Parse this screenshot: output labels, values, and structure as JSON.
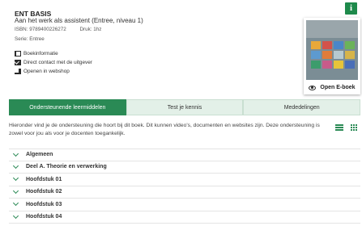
{
  "book": {
    "title": "ENT BASIS",
    "subtitle": "Aan het werk als assistent (Entree, niveau 1)",
    "isbn": "ISBN: 9789400226272",
    "druk": "Druk: 1hz",
    "serie": "Serie: Entree"
  },
  "info_badge": "i",
  "links": [
    {
      "label": "Boekinformatie",
      "icon": "book-icon"
    },
    {
      "label": "Direct contact met de uitgever",
      "icon": "mail-icon"
    },
    {
      "label": "Openen in webshop",
      "icon": "cart-icon"
    }
  ],
  "ebook": {
    "button_label": "Open E-boek"
  },
  "tabs": [
    {
      "label": "Ondersteunende leermiddelen",
      "active": true
    },
    {
      "label": "Test je kennis",
      "active": false
    },
    {
      "label": "Mededelingen",
      "active": false
    }
  ],
  "description": "Hieronder vind je de ondersteuning die hoort bij dit boek. Dit kunnen video's, documenten en websites zijn. Deze ondersteuning is zowel voor jou als voor je docenten toegankelijk.",
  "accordion": [
    {
      "label": "Algemeen"
    },
    {
      "label": "Deel A. Theorie en verwerking"
    },
    {
      "label": "Hoofdstuk 01"
    },
    {
      "label": "Hoofdstuk 02"
    },
    {
      "label": "Hoofdstuk 03"
    },
    {
      "label": "Hoofdstuk 04"
    }
  ],
  "colors": {
    "accent": "#2a8a55",
    "tab_inactive": "#e3f0e8"
  }
}
